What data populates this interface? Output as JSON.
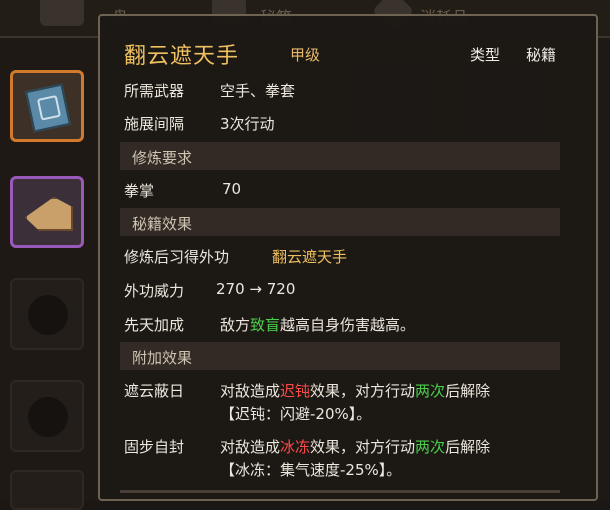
{
  "top_tabs": [
    "盘",
    "秘籍",
    "消耗品"
  ],
  "item": {
    "name": "翻云遮天手",
    "grade": "甲级",
    "type_label": "类型",
    "type_value": "秘籍"
  },
  "stats": {
    "weapon_label": "所需武器",
    "weapon_value": "空手、拳套",
    "interval_label": "施展间隔",
    "interval_value": "3次行动"
  },
  "section_requirements": "修炼要求",
  "requirement": {
    "label": "拳掌",
    "value": "70"
  },
  "section_effects": "秘籍效果",
  "effects": {
    "learn_label": "修炼后习得外功",
    "learn_value": "翻云遮天手",
    "power_label": "外功威力",
    "power_value": "270 → 720",
    "innate_label": "先天加成",
    "innate_pre": "敌方",
    "innate_hl": "致盲",
    "innate_post": "越高自身伤害越高。"
  },
  "section_extra": "附加效果",
  "extras": [
    {
      "name": "遮云蔽日",
      "pre": "对敌造成",
      "status": "迟钝",
      "mid": "效果，对方行动",
      "count": "两次",
      "post": "后解除",
      "detail": "【迟钝：闪避-20%】。"
    },
    {
      "name": "固步自封",
      "pre": "对敌造成",
      "status": "冰冻",
      "mid": "效果，对方行动",
      "count": "两次",
      "post": "后解除",
      "detail": "【冰冻：集气速度-25%】。"
    }
  ],
  "colors": {
    "title": "#f0c060",
    "highlight_green": "#4ad04a",
    "highlight_red": "#ff4a4a",
    "slot_orange": "#d27a2c",
    "slot_purple": "#9a58b8"
  },
  "icons": [
    "book-icon",
    "fan-scroll-icon"
  ]
}
